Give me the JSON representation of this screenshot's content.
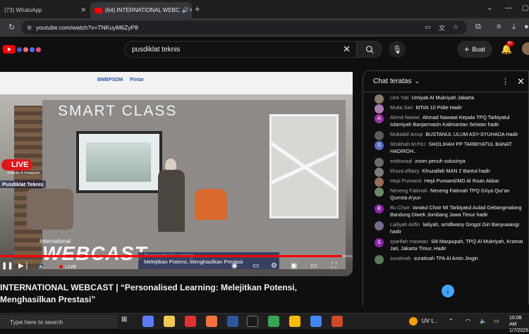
{
  "browser": {
    "tabs": [
      {
        "title": "(73) WhatsApp",
        "active": false
      },
      {
        "title": "(64) INTERNATIONAL WEBC",
        "active": true
      }
    ],
    "url": "youtube.com/watch?v=TNKuyM6ZyP8"
  },
  "youtube": {
    "search_query": "pusdiklat teknis",
    "create_label": "Buat",
    "notification_badge": "9+"
  },
  "video": {
    "banner_logos": [
      "BMBPSDM",
      "Pintar"
    ],
    "scene_text": "SMART CLASS",
    "live_badge": "LIVE",
    "live_sub": "Youtube & Instagram",
    "live_channel": "Pusdiklat Teknis",
    "webcast_small": "International",
    "webcast_big": "WEBCAST",
    "ticker_line1": "Personalised Learning:",
    "ticker_line2": "Melejitkan Potensi, Menghasilkan Prestasi",
    "live_label": "LIVE",
    "progress": 0.97
  },
  "title": "INTERNATIONAL WEBCAST | “Personalised Learning: Melejitkan Potensi, Menghasilkan Prestasi”",
  "chat": {
    "header": "Chat teratas",
    "messages": [
      {
        "author": "Umi Yati",
        "text": "Umiyati Al Mukriyah Jakarta",
        "color": "#8a7a6a",
        "initial": ""
      },
      {
        "author": "Mutia Sari",
        "text": "MTsN 10 Pidie Hadir",
        "color": "#b07ab8",
        "initial": ""
      },
      {
        "author": "Ahmd Nawwi",
        "text": "Ahmad Nawawi Kepala TPQ Tarbiyatul Islamiyah Banjarmasin Kalimantan Selatan hadir",
        "color": "#9c2fa8",
        "initial": "A"
      },
      {
        "author": "Muktakif Amuji",
        "text": "BUSTANUL ULUM ASY-SYUHADA Hadir",
        "color": "#5a5a5a",
        "initial": ""
      },
      {
        "author": "Sholihah M.Pd.I",
        "text": "SHOLIHAH PP TARBIYATUL BANAT HADIROH..",
        "color": "#5c6bc0",
        "initial": "S"
      },
      {
        "author": "estikoraqf",
        "text": "zoom penuh solusinya",
        "color": "#6a6a6a",
        "initial": ""
      },
      {
        "author": "khuza elfaizy",
        "text": "Khuzaifah MAN 2 Bantul hadir",
        "color": "#7a7a7a",
        "initial": ""
      },
      {
        "author": "Hepi Purwanti",
        "text": "Hepi Purwanti/MD Al Ihsan Akbar",
        "color": "#9a6a5a",
        "initial": ""
      },
      {
        "author": "Neneng Fatimah",
        "text": "Neneng Fatimah TPQ Griya Qur'an Qurrota A'yun",
        "color": "#6a8a6a",
        "initial": ""
      },
      {
        "author": "Bu Choir",
        "text": "Ianatul Choir MI Tarbiyatul Aulad Gebangmalang Bandung Diwek Jombang Jawa Timur hadir",
        "color": "#8e24aa",
        "initial": "B"
      },
      {
        "author": "Lailiyah Arifin",
        "text": "lailiyah, arridlwany Grogol Giri Banyuwangi hadir",
        "color": "#7a6a8a",
        "initial": ""
      },
      {
        "author": "syarifah maswan",
        "text": "Siti Maspupah, TPQ Al Mukriyah, Kramat Jati, Jakarta Timur, Hadir",
        "color": "#8e24aa",
        "initial": "S"
      },
      {
        "author": "suratinah",
        "text": "suratinah TPA Al Amin Jingin",
        "color": "#5a7a5a",
        "initial": ""
      }
    ]
  },
  "taskbar": {
    "search_placeholder": "Type here to search",
    "weather": "UV t...",
    "time": "10:08 AM",
    "date": "1/7/2025"
  }
}
